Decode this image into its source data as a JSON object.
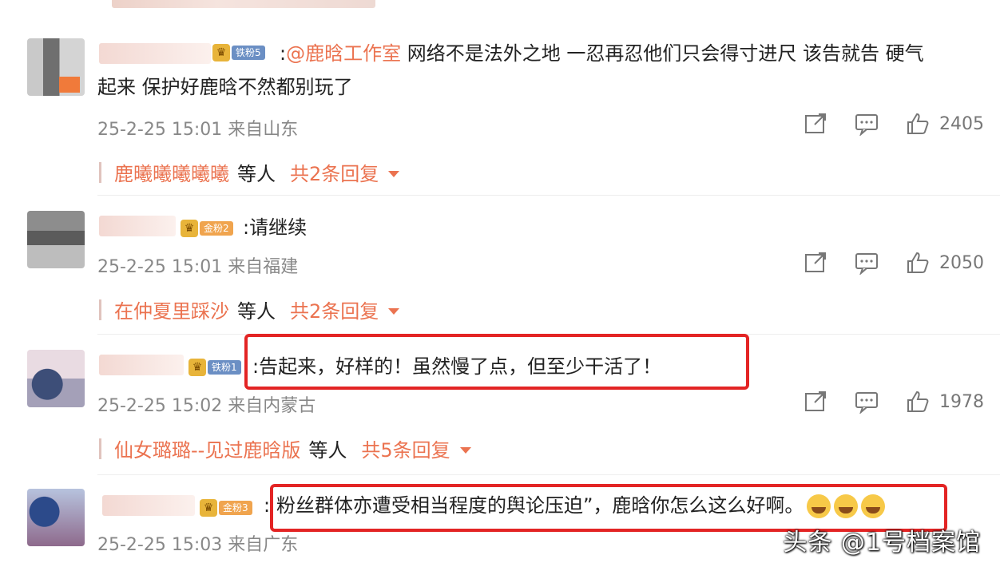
{
  "comments": [
    {
      "badge": "铁粉5",
      "mention": "@鹿晗工作室",
      "text_a": "网络不是法外之地 一忍再忍他们只会得寸进尺 该告就告 硬气",
      "text_b": "起来 保护好鹿晗不然都别玩了",
      "meta": "25-2-25 15:01 来自山东",
      "likes": "2405",
      "reply_user": "鹿曦曦曦曦曦",
      "reply_others": "等人",
      "reply_count": "共2条回复"
    },
    {
      "badge": "金粉2",
      "text": ":请继续",
      "meta": "25-2-25 15:01 来自福建",
      "likes": "2050",
      "reply_user": "在仲夏里踩沙",
      "reply_others": "等人",
      "reply_count": "共2条回复"
    },
    {
      "badge": "铁粉1",
      "text": ":告起来，好样的！虽然慢了点，但至少干活了！",
      "meta": "25-2-25 15:02 来自内蒙古",
      "likes": "1978",
      "reply_user": "仙女璐璐--见过鹿晗版",
      "reply_others": "等人",
      "reply_count": "共5条回复"
    },
    {
      "badge": "金粉3",
      "prefix": ":",
      "text": "粉丝群体亦遭受相当程度的舆论压迫”，鹿晗你怎么这么好啊。",
      "meta": "25-2-25 15:03 来自广东"
    }
  ],
  "watermark": "头条 @1号档案馆",
  "icons": [
    "share-icon",
    "comment-icon",
    "like-icon",
    "caret-down-icon",
    "crown-icon"
  ],
  "colors": {
    "accent": "#eb7350",
    "highlight_box": "#e32424",
    "meta": "#888888"
  }
}
